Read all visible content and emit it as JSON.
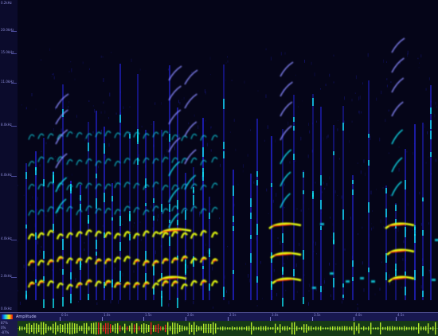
{
  "frequency_axis": {
    "labels": [
      "0.2kHz",
      "20.0kHz",
      "15.0kHz",
      "11.0kHz",
      "8.0kHz",
      "6.0kHz",
      "4.0kHz",
      "2.0kHz",
      "0.0kHz"
    ]
  },
  "amplitude_panel": {
    "label": "Amplitude",
    "scale": [
      "87%",
      "0%",
      "-87%"
    ]
  },
  "time_axis": {
    "labels": [
      "0.5s",
      "1.0s",
      "1.5s",
      "2.0s",
      "2.5s",
      "3.0s",
      "3.5s",
      "4.0s",
      "4.5s"
    ]
  },
  "colors": {
    "background": "#050518",
    "low": "#2a2aff",
    "mid": "#10e0f0",
    "high": "#e8ff10",
    "peak": "#ff2010",
    "waveform": "#c8ff30",
    "waveform_clipped": "#ff2020"
  }
}
